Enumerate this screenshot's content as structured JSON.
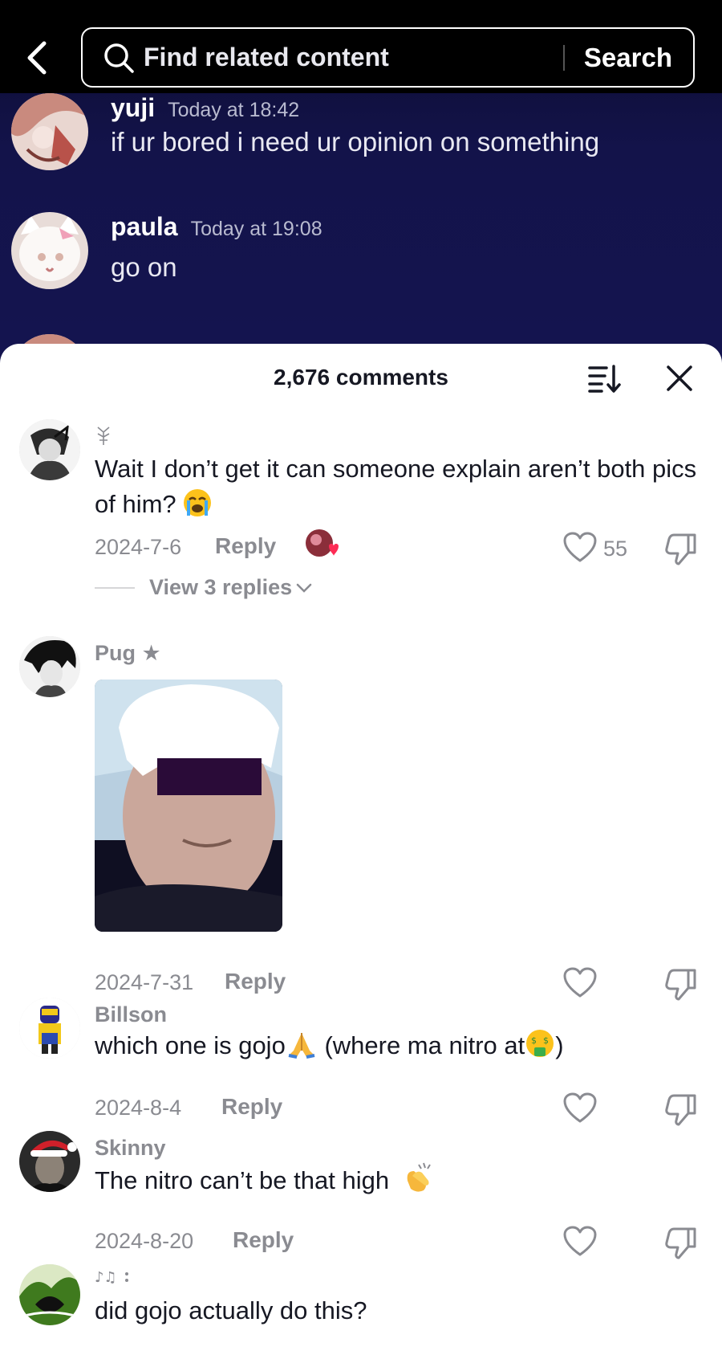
{
  "search": {
    "placeholder": "Find related content",
    "button_label": "Search"
  },
  "chat": [
    {
      "name": "yuji",
      "time": "Today at 18:42",
      "text": "if ur bored i need ur opinion on something"
    },
    {
      "name": "paula",
      "time": "Today at 19:08",
      "text": "go on"
    }
  ],
  "comments_header": {
    "count_label": "2,676 comments"
  },
  "comments": [
    {
      "username": "",
      "text": "Wait I don’t get it can someone explain aren’t both pics of him?",
      "emoji": "loudly-crying-face",
      "date": "2024-7-6",
      "reply_label": "Reply",
      "likes": "55",
      "view_replies": "View 3 replies"
    },
    {
      "username": "Pug ★",
      "date": "2024-7-31",
      "reply_label": "Reply"
    },
    {
      "username": "Billson",
      "text_a": "which one is gojo",
      "text_b": " (where ma nitro at",
      "text_c": ")",
      "date": "2024-8-4",
      "reply_label": "Reply"
    },
    {
      "username": "Skinny",
      "text": "The nitro can’t be that high",
      "date": "2024-8-20",
      "reply_label": "Reply"
    },
    {
      "username": "",
      "text": "did gojo actually do this?"
    }
  ],
  "colors": {
    "topbar": "#000000",
    "video_bg": "#13134a",
    "secondary_text": "#8a8b91",
    "primary_text": "#161823"
  }
}
